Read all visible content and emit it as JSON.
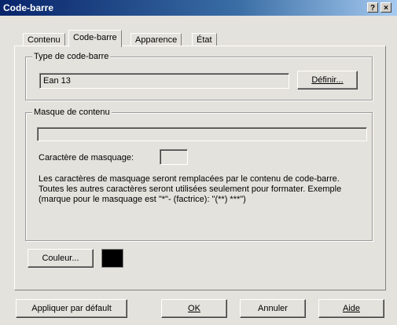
{
  "window": {
    "title": "Code-barre",
    "help_button": "?",
    "close_button": "×"
  },
  "tabs": [
    {
      "label": "Contenu"
    },
    {
      "label": "Code-barre"
    },
    {
      "label": "Apparence"
    },
    {
      "label": "État"
    }
  ],
  "barcode_type": {
    "legend": "Type de code-barre",
    "value": "Ean 13",
    "define_button": "Définir..."
  },
  "content_mask": {
    "legend": "Masque de contenu",
    "mask_value": "",
    "mask_char_label": "Caractère de masquage:",
    "mask_char_value": "",
    "description": "Les caractères de masquage seront remplacées par le contenu de code-barre. Toutes les autres caractères seront utilisées seulement pour formater. Exemple (marque pour le masquage est \"*\"- (factrice): \"(**) ***\")"
  },
  "color": {
    "button_label": "Couleur...",
    "swatch_color": "#000000"
  },
  "footer": {
    "apply_default": "Appliquer par défault",
    "ok": "OK",
    "cancel": "Annuler",
    "help": "Aide"
  }
}
